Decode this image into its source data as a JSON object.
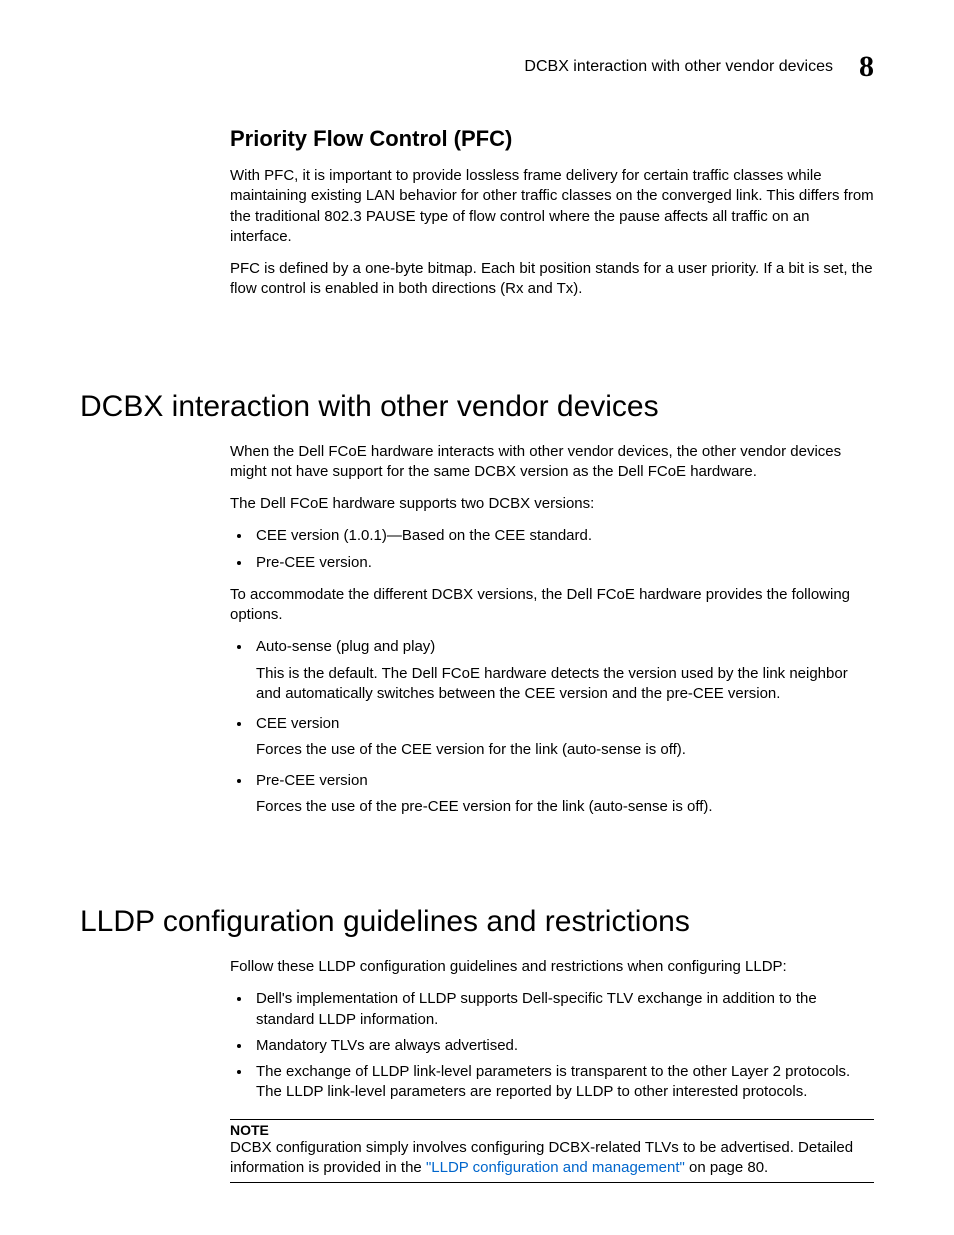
{
  "header": {
    "running_title": "DCBX interaction with other vendor devices",
    "chapter_number": "8"
  },
  "section_pfc": {
    "heading": "Priority Flow Control (PFC)",
    "para1": "With PFC, it is important to provide lossless frame delivery for certain traffic classes while maintaining existing LAN behavior for other traffic classes on the converged link. This differs from the traditional 802.3 PAUSE type of flow control where the pause affects all traffic on an interface.",
    "para2": "PFC is defined by a one-byte bitmap. Each bit position stands for a user priority. If a bit is set, the flow control is enabled in both directions (Rx and Tx)."
  },
  "section_dcbx": {
    "heading": "DCBX interaction with other vendor devices",
    "para1": "When the Dell FCoE hardware interacts with other vendor devices, the other vendor devices might not have support for the same DCBX version as the Dell FCoE hardware.",
    "para2": "The Dell FCoE hardware supports two DCBX versions:",
    "versions": [
      "CEE version (1.0.1)—Based on the CEE standard.",
      "Pre-CEE version."
    ],
    "para3": "To accommodate the different DCBX versions, the Dell FCoE hardware provides the following options.",
    "options": [
      {
        "label": "Auto-sense (plug and play)",
        "desc": "This is the default. The Dell FCoE hardware detects the version used by the link neighbor and automatically switches between the CEE version and the pre-CEE version."
      },
      {
        "label": "CEE version",
        "desc": "Forces the use of the CEE version for the link (auto-sense is off)."
      },
      {
        "label": "Pre-CEE version",
        "desc": "Forces the use of the pre-CEE version for the link (auto-sense is off)."
      }
    ]
  },
  "section_lldp": {
    "heading": "LLDP configuration guidelines and restrictions",
    "para1": "Follow these LLDP configuration guidelines and restrictions when configuring LLDP:",
    "items": [
      "Dell's implementation of LLDP supports Dell-specific TLV exchange in addition to the standard LLDP information.",
      "Mandatory TLVs are always advertised.",
      "The exchange of LLDP link-level parameters is transparent to the other Layer 2 protocols. The LLDP link-level parameters are reported by LLDP to other interested protocols."
    ],
    "note_label": "NOTE",
    "note_body_pre": "DCBX configuration simply involves configuring DCBX-related TLVs to be advertised. Detailed information is provided in the ",
    "note_link": "\"LLDP configuration and management\"",
    "note_body_post": " on page 80."
  }
}
